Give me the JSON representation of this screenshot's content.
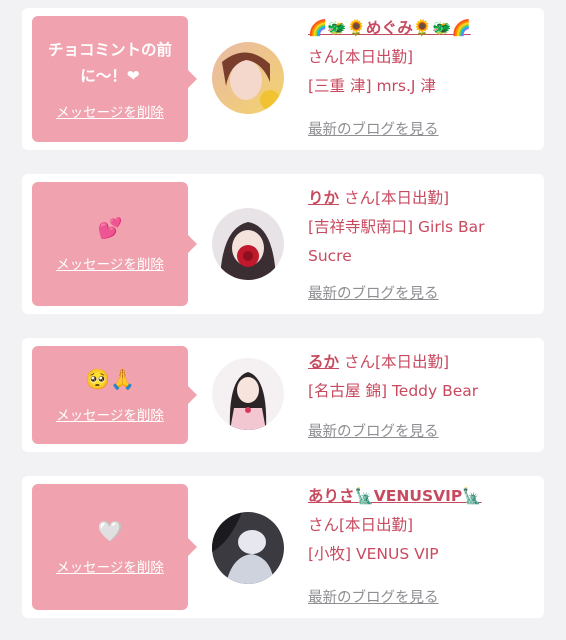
{
  "cards": [
    {
      "message": "チョコミントの前に〜！❤",
      "delete_label": "メッセージを削除",
      "name": "🌈🐲🌻めぐみ🌻🐲🌈",
      "suffix": "さん[本日出勤]",
      "shop": "[三重 津] mrs.J 津",
      "shop2": "",
      "blog_label": "最新のブログを見る"
    },
    {
      "message": "💕",
      "delete_label": "メッセージを削除",
      "name": "りか",
      "suffix": "さん[本日出勤]",
      "shop": "[吉祥寺駅南口] Girls Bar",
      "shop2": "Sucre",
      "blog_label": "最新のブログを見る"
    },
    {
      "message": "🥺🙏",
      "delete_label": "メッセージを削除",
      "name": "るか",
      "suffix": "さん[本日出勤]",
      "shop": "[名古屋 錦] Teddy Bear",
      "shop2": "",
      "blog_label": "最新のブログを見る"
    },
    {
      "message": "🤍",
      "delete_label": "メッセージを削除",
      "name": "ありさ🗽VENUSVIP🗽",
      "suffix": "さん[本日出勤]",
      "shop": "[小牧] VENUS VIP",
      "shop2": "",
      "blog_label": "最新のブログを見る"
    }
  ],
  "colors": {
    "bubble": "#f0a3ae",
    "accent_text": "#c84a5f",
    "link_gray": "#8e8e93",
    "background": "#f2f2f4"
  }
}
